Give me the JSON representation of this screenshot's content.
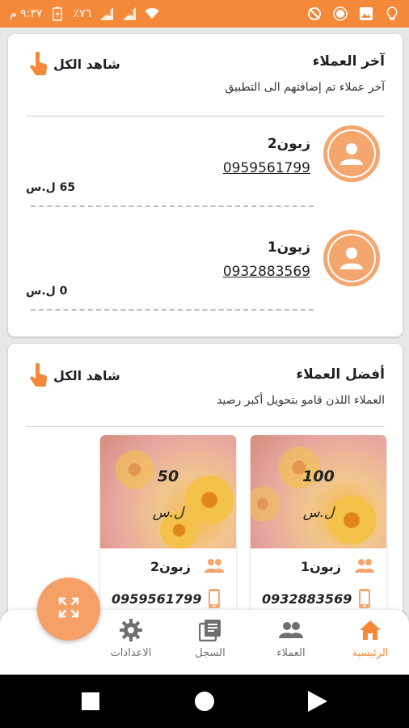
{
  "status_bar": {
    "time": "٩:٣٧ م",
    "battery": "٪٧٦"
  },
  "recent_customers": {
    "title": "آخر العملاء",
    "subtitle": "آخر عملاء تم إضافتهم الى التطبيق",
    "see_all": "شاهد الكل",
    "items": [
      {
        "name": "زبون2",
        "phone": "0959561799",
        "balance": "65 ل.س"
      },
      {
        "name": "زبون1",
        "phone": "0932883569",
        "balance": "0 ل.س"
      }
    ]
  },
  "top_customers": {
    "title": "أفضل العملاء",
    "subtitle": "العملاء اللذن قامو بتحويل أكبر رصيد",
    "see_all": "شاهد الكل",
    "items": [
      {
        "amount": "100",
        "currency": "ل.س",
        "name": "زبون1",
        "phone": "0932883569"
      },
      {
        "amount": "50",
        "currency": "ل.س",
        "name": "زبون2",
        "phone": "0959561799"
      }
    ]
  },
  "bottom_nav": {
    "items": [
      {
        "label": "الرئيسية",
        "icon": "home-icon",
        "active": true
      },
      {
        "label": "العملاء",
        "icon": "people-icon",
        "active": false
      },
      {
        "label": "السجل",
        "icon": "library-icon",
        "active": false
      },
      {
        "label": "الاعدادات",
        "icon": "gear-icon",
        "active": false
      }
    ]
  },
  "colors": {
    "accent": "#f5893a",
    "accent_light": "#f5a66e",
    "nav_inactive": "#6f6f6f"
  }
}
